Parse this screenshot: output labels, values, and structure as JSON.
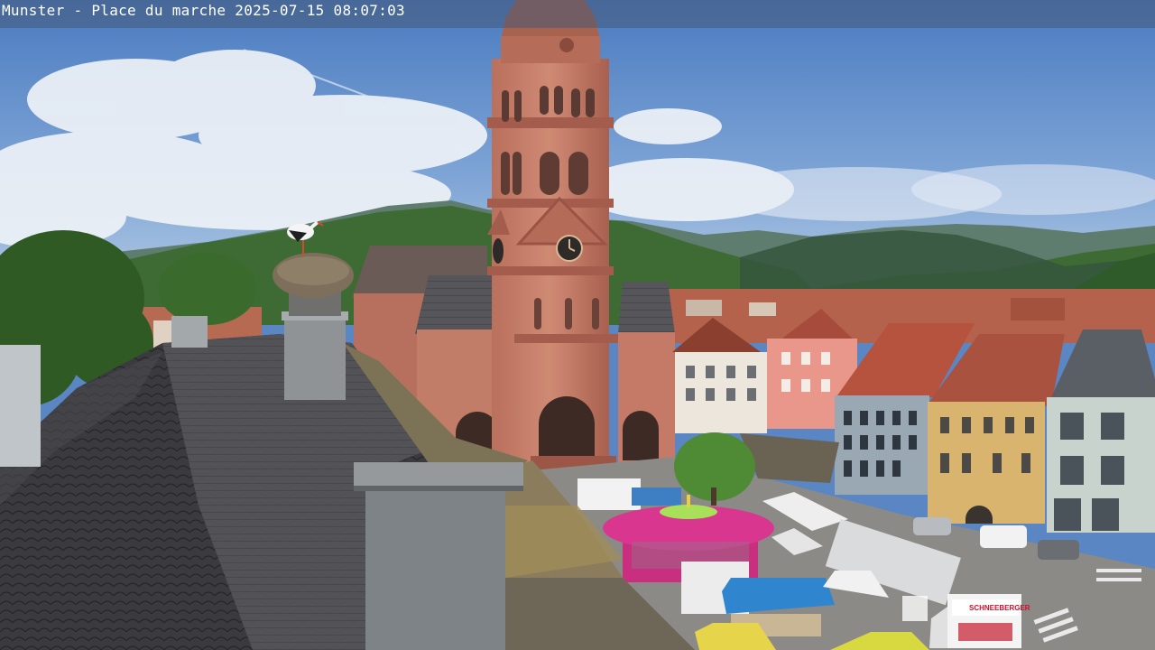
{
  "webcam": {
    "location": "Munster - Place du marche",
    "date": "2025-07-15",
    "time": "08:07:03"
  },
  "scene": {
    "van_sign": "SCHNEEBERGER",
    "colors": {
      "sky_top": "#4f7fc2",
      "sky_bottom": "#9dbde0",
      "cloud": "#eef2f7",
      "sandstone": "#c47a66",
      "sandstone_dark": "#a45d4d",
      "roof_slate": "#4a4a4d",
      "carousel": "#d8368f",
      "canopy_blue": "#2f86cf",
      "forest": "#3d6b33"
    }
  }
}
